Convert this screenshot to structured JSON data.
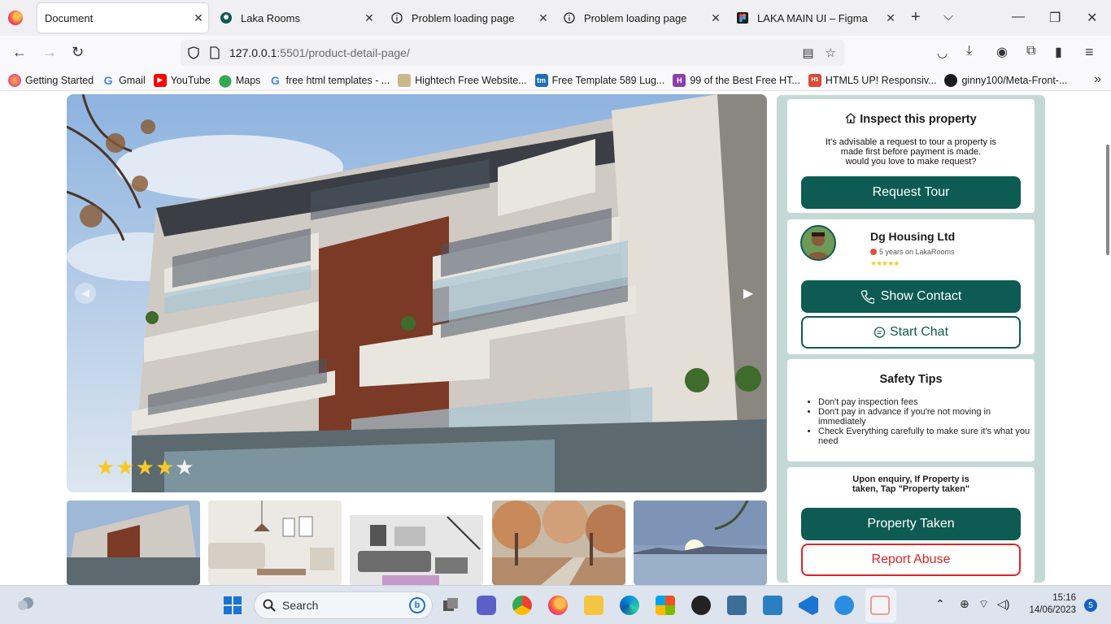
{
  "browser": {
    "tabs": [
      {
        "title": "Document",
        "active": true
      },
      {
        "title": "Laka Rooms",
        "active": false
      },
      {
        "title": "Problem loading page",
        "active": false
      },
      {
        "title": "Problem loading page",
        "active": false
      },
      {
        "title": "LAKA MAIN UI – Figma",
        "active": false
      }
    ],
    "url_host": "127.0.0.1",
    "url_rest": ":5501/product-detail-page/",
    "bookmarks": [
      "Getting Started",
      "Gmail",
      "YouTube",
      "Maps",
      "free html templates - ...",
      "Hightech Free Website...",
      "Free Template 589 Lug...",
      "99 of the Best Free HT...",
      "HTML5 UP! Responsiv...",
      "ginny100/Meta-Front-..."
    ]
  },
  "gallery": {
    "rating": 4,
    "rating_max": 5,
    "thumbnail_count": 5
  },
  "inspect": {
    "title": "Inspect this property",
    "line1": "It's advisable a request to tour a property is",
    "line2": "made first before payment is made.",
    "line3": "would you love to make request?",
    "button": "Request Tour"
  },
  "agent": {
    "name": "Dg Housing Ltd",
    "tenure": "5 years on LakaRooms",
    "stars": "★★★★★",
    "show_contact": "Show Contact",
    "start_chat": "Start Chat"
  },
  "safety": {
    "title": "Safety Tips",
    "tips": [
      "Don't pay inspection fees",
      "Don't pay in advance if you're not moving in immediately",
      "Check Everything carefully to make sure it's what you need"
    ]
  },
  "enquiry": {
    "line1": "Upon enquiry, If Property is",
    "line2": "taken, Tap \"Property taken\"",
    "taken_button": "Property Taken",
    "report_button": "Report Abuse"
  },
  "taskbar": {
    "search_placeholder": "Search",
    "time": "15:16",
    "date": "14/06/2023",
    "notifications": "5"
  },
  "colors": {
    "brand": "#0d5b52",
    "sidebar_bg": "#c4d9d5",
    "danger": "#e02424",
    "star": "#f8c925"
  }
}
